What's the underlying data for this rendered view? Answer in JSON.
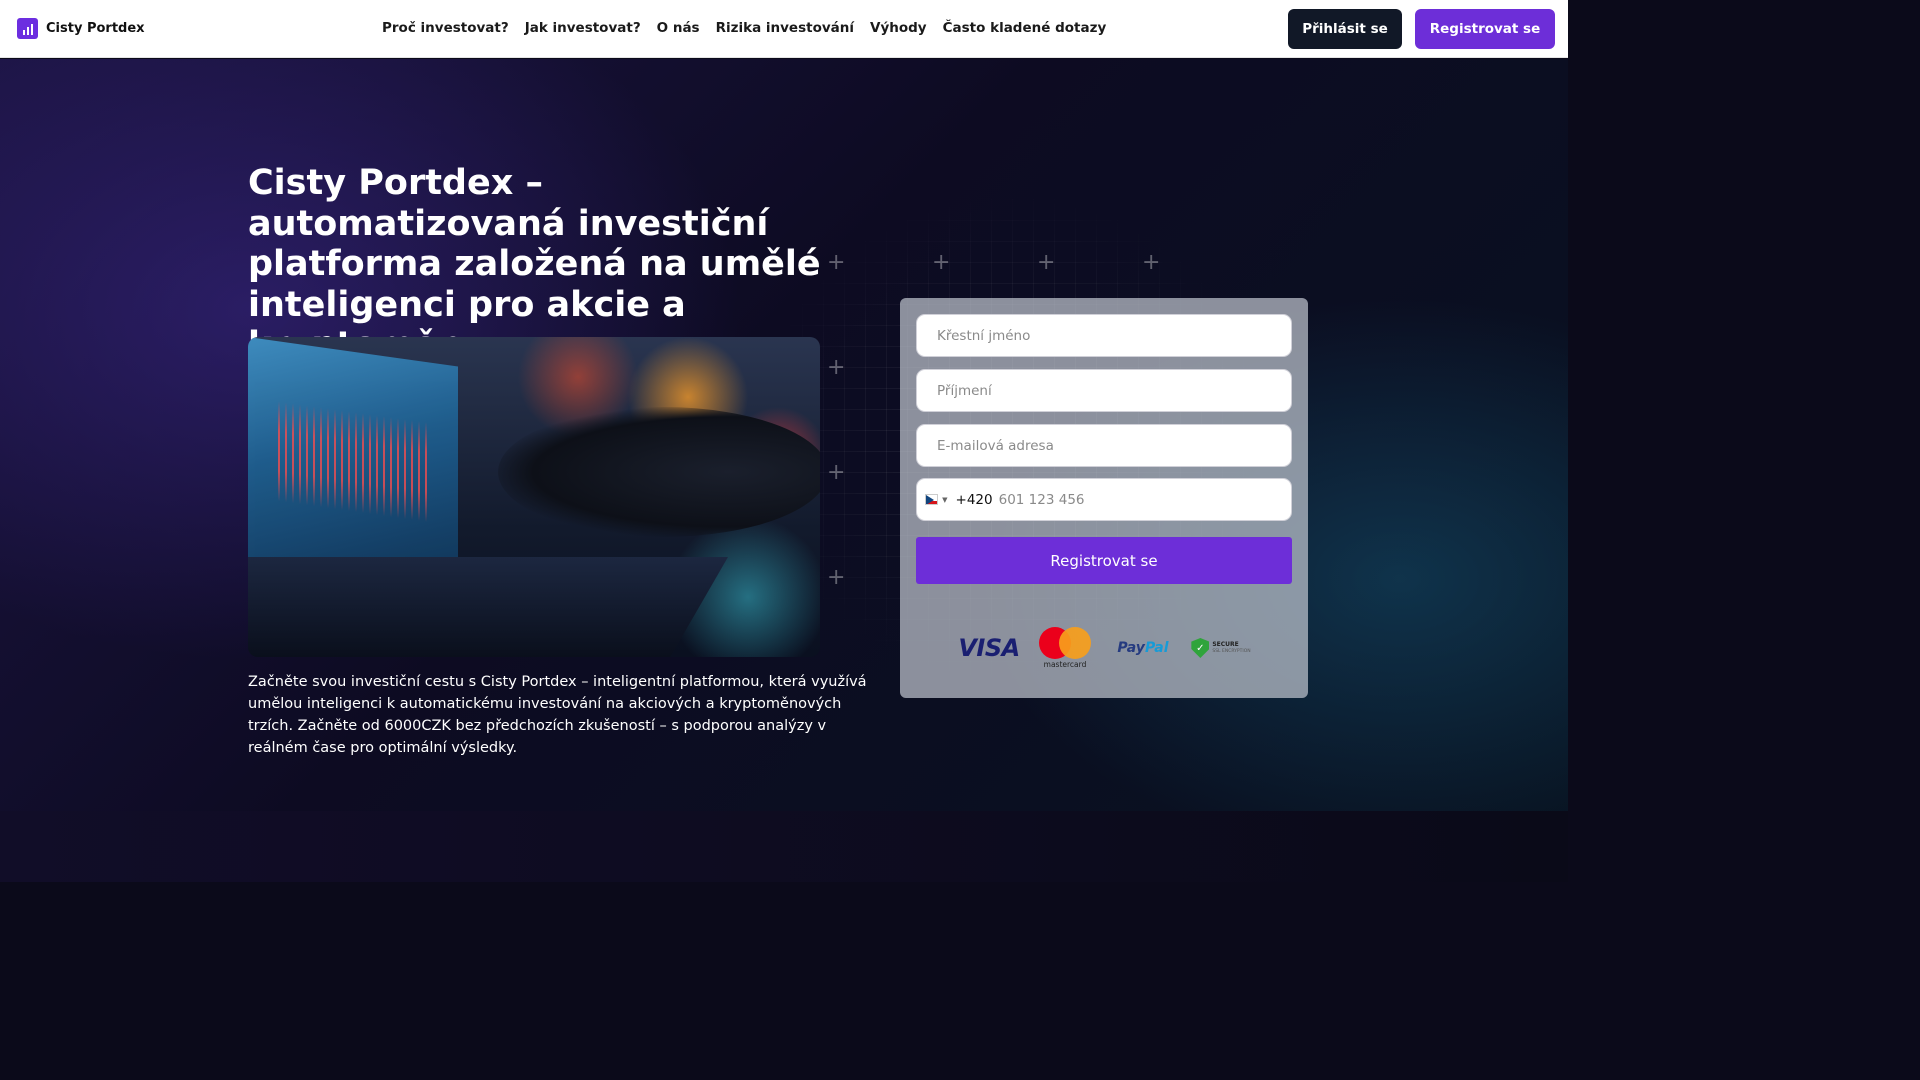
{
  "header": {
    "brand": "Cisty Portdex",
    "nav": [
      "Proč investovat?",
      "Jak investovat?",
      "O nás",
      "Rizika investování",
      "Výhody",
      "Často kladené dotazy"
    ],
    "login_label": "Přihlásit se",
    "register_label": "Registrovat se"
  },
  "hero": {
    "title": "Cisty Portdex – automatizovaná investiční platforma založená na umělé inteligenci pro akcie a kryptoměny",
    "description": "Začněte svou investiční cestu s Cisty Portdex – inteligentní platformou, která využívá umělou inteligenci k automatickému investování na akciových a kryptoměnových trzích. Začněte od 6000CZK bez předchozích zkušeností – s podporou analýzy v reálném čase pro optimální výsledky."
  },
  "form": {
    "first_name_placeholder": "Křestní jméno",
    "last_name_placeholder": "Příjmení",
    "email_placeholder": "E-mailová adresa",
    "phone_country": "CZ",
    "phone_dial_code": "+420",
    "phone_placeholder": "601 123 456",
    "submit_label": "Registrovat se"
  },
  "payment_logos": {
    "visa": "VISA",
    "mastercard_label": "mastercard",
    "paypal_pay": "Pay",
    "paypal_pal": "Pal",
    "secure_title": "SECURE",
    "secure_sub": "SSL ENCRYPTION"
  },
  "colors": {
    "accent": "#6d2ed8",
    "dark_button": "#111827"
  }
}
